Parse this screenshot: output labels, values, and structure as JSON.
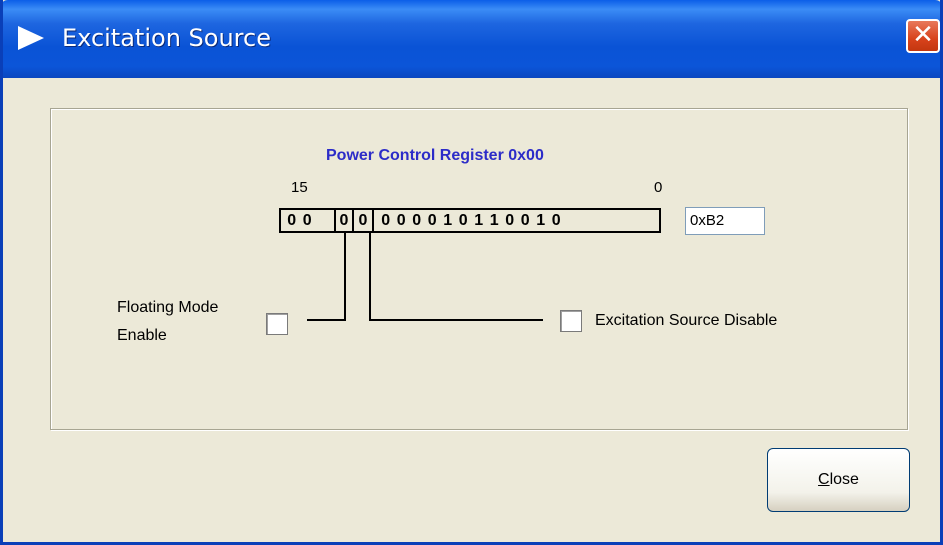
{
  "window": {
    "title": "Excitation Source",
    "close_glyph": "✕"
  },
  "register": {
    "title": "Power Control Register 0x00",
    "msb_label": "15",
    "lsb_label": "0",
    "bits_group_a": [
      "0",
      "0"
    ],
    "bit_floating": "0",
    "bit_excitation": "0",
    "bits_group_b": [
      "0",
      "0",
      "0",
      "0",
      "1",
      "0",
      "1",
      "1",
      "0",
      "0",
      "1",
      "0"
    ],
    "hex_value": "0xB2"
  },
  "floating_mode": {
    "label_line1": "Floating Mode",
    "label_line2": "Enable",
    "checked": false
  },
  "excitation_disable": {
    "label": "Excitation Source Disable",
    "checked": false
  },
  "buttons": {
    "close_mnemonic": "C",
    "close_rest": "lose"
  },
  "colors": {
    "titlebar": "#0a53d6",
    "register_title": "#2c2cc8",
    "dialog_bg": "#ece9d8"
  },
  "icons": {
    "title_icon": "play-triangle-icon",
    "close_icon": "close-x-icon"
  }
}
